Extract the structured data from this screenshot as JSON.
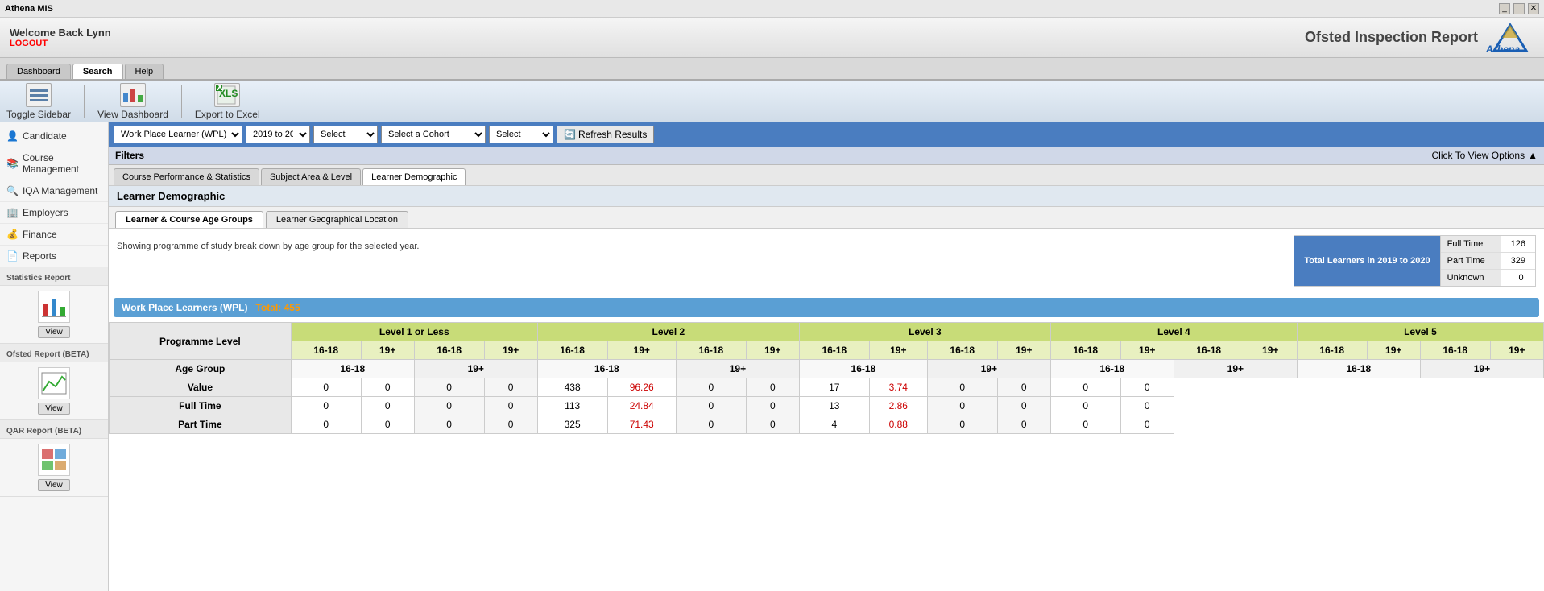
{
  "titleBar": {
    "appName": "Athena MIS",
    "controls": [
      "_",
      "□",
      "✕"
    ]
  },
  "header": {
    "welcomeText": "Welcome Back Lynn",
    "logoutLabel": "LOGOUT",
    "reportTitle": "Ofsted Inspection Report",
    "logoText": "Athena"
  },
  "navTabs": [
    {
      "label": "Dashboard",
      "active": false
    },
    {
      "label": "Search",
      "active": true
    },
    {
      "label": "Help",
      "active": false
    }
  ],
  "toolbar": [
    {
      "label": "Toggle Sidebar",
      "icon": "☰"
    },
    {
      "label": "View Dashboard",
      "icon": "📊"
    },
    {
      "label": "Export to Excel",
      "icon": "XLS"
    }
  ],
  "filters": {
    "label": "Filters",
    "dropdown1": {
      "value": "Work Place Learner (WPL)",
      "options": [
        "Work Place Learner (WPL)"
      ]
    },
    "dropdown2": {
      "value": "2019 to 20...",
      "options": [
        "2019 to 20..."
      ]
    },
    "dropdown3": {
      "value": "Select",
      "options": [
        "Select"
      ]
    },
    "dropdown4": {
      "value": "Select a Cohort",
      "options": [
        "Select a Cohort"
      ]
    },
    "dropdown5": {
      "value": "Select",
      "options": [
        "Select"
      ]
    },
    "refreshBtn": "Refresh Results",
    "viewOptionsBtn": "Click To View Options"
  },
  "subTabs": [
    {
      "label": "Course Performance & Statistics",
      "active": false
    },
    {
      "label": "Subject Area & Level",
      "active": false
    },
    {
      "label": "Learner Demographic",
      "active": true
    }
  ],
  "learnerDemographic": {
    "title": "Learner Demographic",
    "innerTabs": [
      {
        "label": "Learner & Course Age Groups",
        "active": true
      },
      {
        "label": "Learner Geographical Location",
        "active": false
      }
    ],
    "descText": "Showing programme of study break down by age group for the selected year.",
    "statsBox": {
      "title": "Total Learners in 2019 to 2020",
      "rows": [
        {
          "label": "Full Time",
          "value": "126"
        },
        {
          "label": "Part Time",
          "value": "329"
        },
        {
          "label": "Unknown",
          "value": "0"
        }
      ]
    }
  },
  "wplSection": {
    "title": "Work Place Learners (WPL)",
    "total": "Total: 455",
    "tableHeaders": {
      "programmeLevel": "Programme Level",
      "level1": "Level 1 or Less",
      "level2": "Level 2",
      "level3": "Level 3",
      "level4": "Level 4",
      "level5": "Level 5"
    },
    "ageGroupLabel": "Age Group",
    "ageGroups": [
      "16-18",
      "19+",
      "16-18",
      "19+",
      "16-18",
      "19+",
      "16-18",
      "19+",
      "16-18",
      "19+"
    ],
    "rows": [
      {
        "label": "Value",
        "cells": [
          {
            "val": "0",
            "red": false
          },
          {
            "val": "0",
            "red": false
          },
          {
            "val": "0",
            "red": false
          },
          {
            "val": "0",
            "red": false
          },
          {
            "val": "438",
            "red": false
          },
          {
            "val": "96.26",
            "red": true
          },
          {
            "val": "0",
            "red": false
          },
          {
            "val": "0",
            "red": false
          },
          {
            "val": "17",
            "red": false
          },
          {
            "val": "3.74",
            "red": true
          },
          {
            "val": "0",
            "red": false
          },
          {
            "val": "0",
            "red": false
          },
          {
            "val": "0",
            "red": false
          },
          {
            "val": "0",
            "red": false
          }
        ]
      },
      {
        "label": "Full Time",
        "cells": [
          {
            "val": "0",
            "red": false
          },
          {
            "val": "0",
            "red": false
          },
          {
            "val": "0",
            "red": false
          },
          {
            "val": "0",
            "red": false
          },
          {
            "val": "113",
            "red": false
          },
          {
            "val": "24.84",
            "red": true
          },
          {
            "val": "0",
            "red": false
          },
          {
            "val": "0",
            "red": false
          },
          {
            "val": "13",
            "red": false
          },
          {
            "val": "2.86",
            "red": true
          },
          {
            "val": "0",
            "red": false
          },
          {
            "val": "0",
            "red": false
          },
          {
            "val": "0",
            "red": false
          },
          {
            "val": "0",
            "red": false
          }
        ]
      },
      {
        "label": "Part Time",
        "cells": [
          {
            "val": "0",
            "red": false
          },
          {
            "val": "0",
            "red": false
          },
          {
            "val": "0",
            "red": false
          },
          {
            "val": "0",
            "red": false
          },
          {
            "val": "325",
            "red": false
          },
          {
            "val": "71.43",
            "red": true
          },
          {
            "val": "0",
            "red": false
          },
          {
            "val": "0",
            "red": false
          },
          {
            "val": "4",
            "red": false
          },
          {
            "val": "0.88",
            "red": true
          },
          {
            "val": "0",
            "red": false
          },
          {
            "val": "0",
            "red": false
          },
          {
            "val": "0",
            "red": false
          },
          {
            "val": "0",
            "red": false
          }
        ]
      }
    ]
  },
  "sidebar": {
    "items": [
      {
        "label": "Candidate",
        "icon": "👤"
      },
      {
        "label": "Course Management",
        "icon": "📚"
      },
      {
        "label": "IQA Management",
        "icon": "🔍"
      },
      {
        "label": "Employers",
        "icon": "🏢"
      },
      {
        "label": "Finance",
        "icon": "💰"
      },
      {
        "label": "Reports",
        "icon": "📄"
      }
    ],
    "reportSections": [
      {
        "title": "Statistics Report",
        "viewLabel": "View"
      },
      {
        "title": "Ofsted Report (BETA)",
        "viewLabel": "View"
      },
      {
        "title": "QAR Report (BETA)",
        "viewLabel": "View"
      }
    ]
  }
}
